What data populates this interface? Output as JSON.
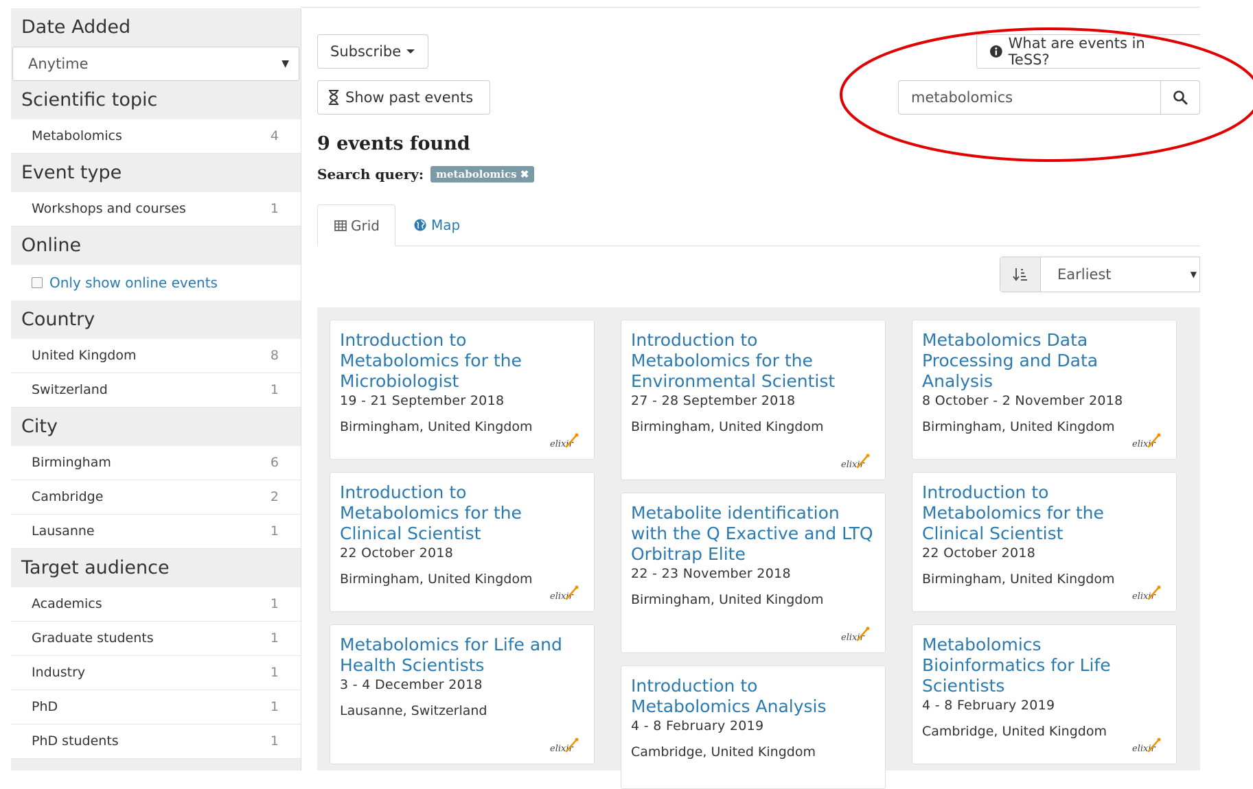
{
  "sidebar": {
    "date_added": {
      "heading": "Date Added",
      "select_value": "Anytime"
    },
    "facets_a": [
      {
        "heading": "Scientific topic",
        "items": [
          {
            "label": "Metabolomics",
            "count": "4"
          }
        ]
      },
      {
        "heading": "Event type",
        "items": [
          {
            "label": "Workshops and courses",
            "count": "1"
          }
        ]
      }
    ],
    "online": {
      "heading": "Online",
      "checkbox_label": "Only show online events"
    },
    "facets_b": [
      {
        "heading": "Country",
        "items": [
          {
            "label": "United Kingdom",
            "count": "8"
          },
          {
            "label": "Switzerland",
            "count": "1"
          }
        ]
      },
      {
        "heading": "City",
        "items": [
          {
            "label": "Birmingham",
            "count": "6"
          },
          {
            "label": "Cambridge",
            "count": "2"
          },
          {
            "label": "Lausanne",
            "count": "1"
          }
        ]
      },
      {
        "heading": "Target audience",
        "items": [
          {
            "label": "Academics",
            "count": "1"
          },
          {
            "label": "Graduate students",
            "count": "1"
          },
          {
            "label": "Industry",
            "count": "1"
          },
          {
            "label": "PhD",
            "count": "1"
          },
          {
            "label": "PhD students",
            "count": "1"
          }
        ]
      }
    ]
  },
  "toolbar": {
    "subscribe_label": "Subscribe",
    "past_events_label": "Show past events",
    "info_label": "What are events in TeSS?"
  },
  "search": {
    "value": "metabolomics"
  },
  "results": {
    "count_label": "9 events found",
    "query_label": "Search query:",
    "query_badge": "metabolomics ✖"
  },
  "tabs": {
    "grid": "Grid",
    "map": "Map"
  },
  "sort": {
    "value": "Earliest"
  },
  "cards": [
    {
      "title": "Introduction to Metabolomics for the Microbiologist",
      "date": "19 - 21 September 2018",
      "location": "Birmingham, United Kingdom"
    },
    {
      "title": "Introduction to Metabolomics for the Environmental Scientist",
      "date": "27 - 28 September 2018",
      "location": "Birmingham, United Kingdom"
    },
    {
      "title": "Metabolomics Data Processing and Data Analysis",
      "date": "8 October - 2 November 2018",
      "location": "Birmingham, United Kingdom"
    },
    {
      "title": "Introduction to Metabolomics for the Clinical Scientist",
      "date": "22 October 2018",
      "location": "Birmingham, United Kingdom"
    },
    {
      "title": "Metabolite identification with the Q Exactive and LTQ Orbitrap Elite",
      "date": "22 - 23 November 2018",
      "location": "Birmingham, United Kingdom"
    },
    {
      "title": "Introduction to Metabolomics for the Clinical Scientist",
      "date": "22 October 2018",
      "location": "Birmingham, United Kingdom"
    },
    {
      "title": "Metabolomics for Life and Health Scientists",
      "date": "3 - 4 December 2018",
      "location": "Lausanne, Switzerland"
    },
    {
      "title": "Introduction to Metabolomics Analysis",
      "date": "4 - 8 February 2019",
      "location": "Cambridge, United Kingdom"
    },
    {
      "title": "Metabolomics Bioinformatics for Life Scientists",
      "date": "4 - 8 February 2019",
      "location": "Cambridge, United Kingdom"
    }
  ],
  "colors": {
    "link": "#2a7ab0",
    "highlight_ellipse": "#e00000",
    "badge": "#7a9aa6"
  }
}
